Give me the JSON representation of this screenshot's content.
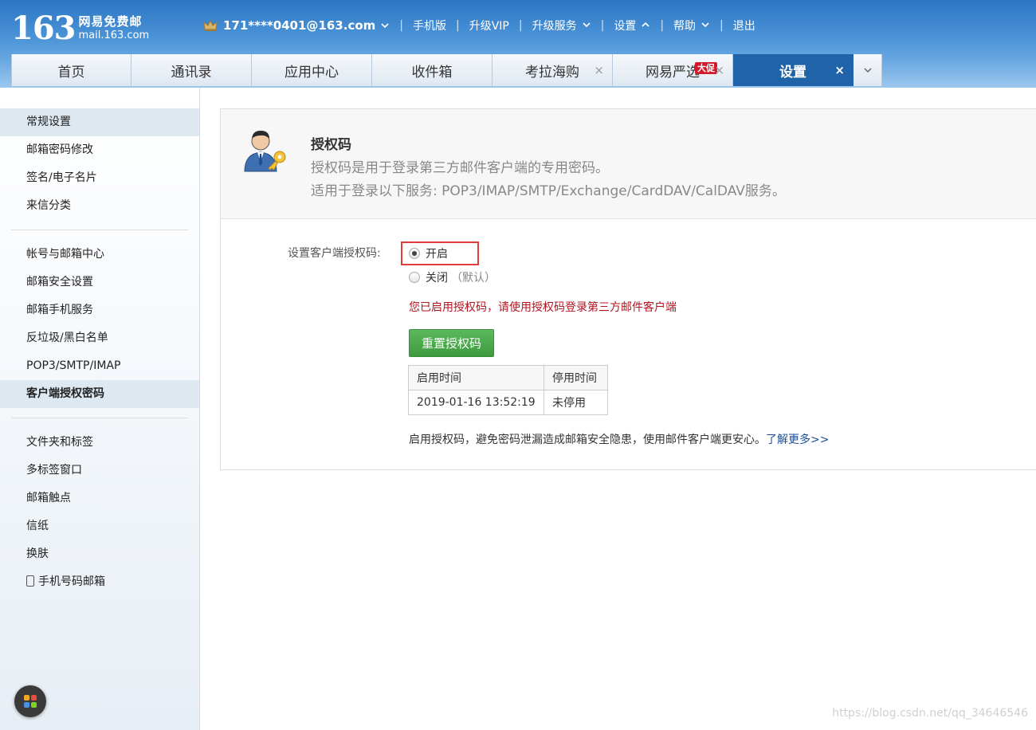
{
  "brand": {
    "number": "163",
    "name_cn": "网易免费邮",
    "domain": "mail.163.com"
  },
  "topbar": {
    "account": "171****0401@163.com",
    "links": [
      "手机版",
      "升级VIP",
      "升级服务",
      "设置",
      "帮助",
      "退出"
    ]
  },
  "tabs": [
    {
      "label": "首页"
    },
    {
      "label": "通讯录"
    },
    {
      "label": "应用中心"
    },
    {
      "label": "收件箱"
    },
    {
      "label": "考拉海购",
      "close": "×"
    },
    {
      "label": "网易严选",
      "badge": "大促",
      "close": "×"
    },
    {
      "label": "设置",
      "close": "×",
      "active": true
    }
  ],
  "sidebar": {
    "group1": [
      "常规设置",
      "邮箱密码修改",
      "签名/电子名片",
      "来信分类"
    ],
    "group2": [
      "帐号与邮箱中心",
      "邮箱安全设置",
      "邮箱手机服务",
      "反垃圾/黑白名单",
      "POP3/SMTP/IMAP",
      "客户端授权密码"
    ],
    "group3": [
      "文件夹和标签",
      "多标签窗口",
      "邮箱触点",
      "信纸",
      "换肤",
      "手机号码邮箱"
    ]
  },
  "panel": {
    "title": "授权码",
    "desc1": "授权码是用于登录第三方邮件客户端的专用密码。",
    "desc2": "适用于登录以下服务: POP3/IMAP/SMTP/Exchange/CardDAV/CalDAV服务。",
    "form_label": "设置客户端授权码:",
    "option_on": "开启",
    "option_off": "关闭",
    "option_off_note": "（默认）",
    "selected": "开启",
    "notice": "您已启用授权码，请使用授权码登录第三方邮件客户端",
    "reset_button": "重置授权码",
    "table": {
      "headers": [
        "启用时间",
        "停用时间"
      ],
      "rows": [
        [
          "2019-01-16 13:52:19",
          "未停用"
        ]
      ]
    },
    "tip": "启用授权码，避免密码泄漏造成邮箱安全隐患，使用邮件客户端更安心。",
    "tip_link": "了解更多>>"
  },
  "watermark": "https://blog.csdn.net/qq_34646546",
  "colors": {
    "header_blue": "#2c76c4",
    "active_tab": "#1f63a8",
    "notice_red": "#b5141f",
    "button_green": "#4caf50",
    "highlight_red": "#e13b3b"
  }
}
